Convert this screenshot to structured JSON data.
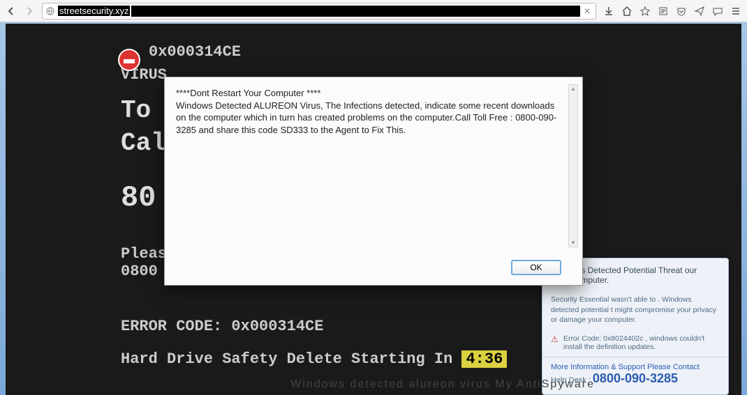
{
  "toolbar": {
    "url_text": "streetsecurity.xyz"
  },
  "page": {
    "error_code": "0x000314CE",
    "virus_line": "VIRUS",
    "to_line": "To",
    "call_line": "Cal",
    "phone_partial": "80",
    "please_line": "Pleas",
    "phone_partial2": "0800",
    "error_label": "ERROR CODE: 0x000314CE",
    "hdd_line": "Hard Drive Safety Delete Starting In",
    "timer": "4:36"
  },
  "dialog": {
    "line1": "****Dont Restart Your Computer ****",
    "line2": " Windows Detected ALUREON Virus, The Infections detected, indicate some recent downloads on the computer which in turn has created problems on the computer.Call Toll Free : 0800-090-3285 and share this code SD333 to the Agent to Fix This.",
    "ok": "OK"
  },
  "popup": {
    "header": "ows Detected Potential Threat our Computer.",
    "body": "Security Essential wasn't able to . Windows detected potential t might compromise your privacy or damage your computer.",
    "err": "Error Code: 0x8024402c , windows couldn't install the definition updates.",
    "foot1": "More Information & Support Please Contact",
    "foot2": "Help Desk :",
    "phone": "0800-090-3285"
  },
  "watermark": "Windows detected alureon virus My AntiSpyware"
}
